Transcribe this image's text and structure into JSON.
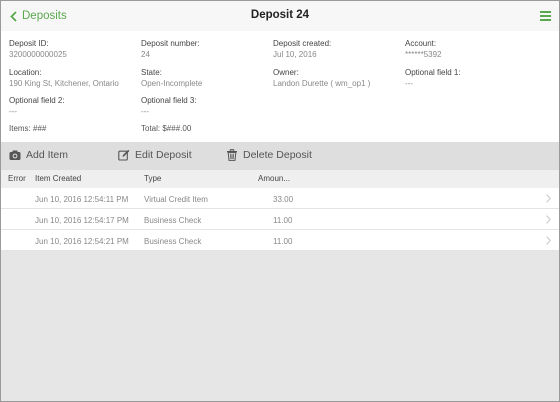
{
  "header": {
    "back_label": "Deposits",
    "title": "Deposit 24"
  },
  "details": {
    "deposit_id": {
      "label": "Deposit ID:",
      "value": "3200000000025"
    },
    "deposit_number": {
      "label": "Deposit number:",
      "value": "24"
    },
    "deposit_created": {
      "label": "Deposit created:",
      "value": "Jul 10, 2016"
    },
    "account": {
      "label": "Account:",
      "value": "******5392"
    },
    "location": {
      "label": "Location:",
      "value": "190 King St, Kitchener, Ontario"
    },
    "state": {
      "label": "State:",
      "value": "Open-Incomplete"
    },
    "owner": {
      "label": "Owner:",
      "value": "Landon Durette ( wm_op1 )"
    },
    "optional_field_1": {
      "label": "Optional field 1:",
      "value": "---"
    },
    "optional_field_2": {
      "label": "Optional field 2:",
      "value": "---"
    },
    "optional_field_3": {
      "label": "Optional field 3:",
      "value": "---"
    },
    "items": "Items: ###",
    "total": "Total: $###.00"
  },
  "toolbar": {
    "add_item": "Add Item",
    "edit_deposit": "Edit Deposit",
    "delete_deposit": "Delete Deposit"
  },
  "table": {
    "headers": {
      "error": "Error",
      "item_created": "Item Created",
      "type": "Type",
      "amount": "Amoun..."
    },
    "rows": [
      {
        "error": "",
        "created": "Jun 10, 2016 12:54:11 PM",
        "type": "Virtual Credit Item",
        "amount": "33.00"
      },
      {
        "error": "",
        "created": "Jun 10, 2016 12:54:17 PM",
        "type": "Business Check",
        "amount": "11.00"
      },
      {
        "error": "",
        "created": "Jun 10, 2016 12:54:21 PM",
        "type": "Business Check",
        "amount": "11.00"
      }
    ]
  },
  "colors": {
    "accent": "#5aa84d",
    "background": "#e6e6e6",
    "toolbar": "#dedede"
  },
  "icons": {
    "back": "chevron-left-icon",
    "menu": "hamburger-menu-icon",
    "add": "camera-icon",
    "edit": "edit-icon",
    "delete": "trash-icon",
    "row": "chevron-right-icon"
  }
}
